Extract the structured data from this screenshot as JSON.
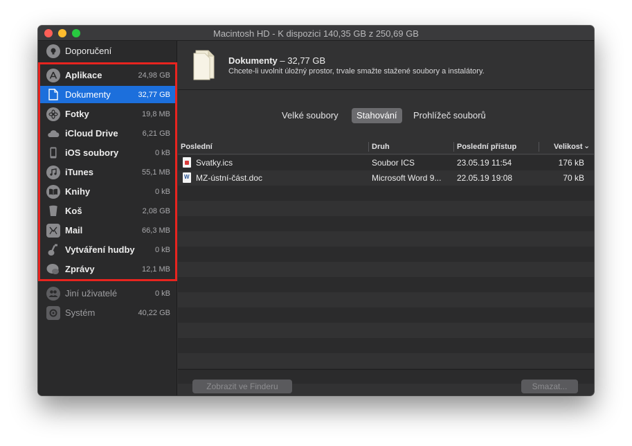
{
  "window": {
    "title": "Macintosh HD - K dispozici 140,35 GB z 250,69 GB"
  },
  "sidebar": {
    "recommendations": {
      "label": "Doporučení",
      "icon": "lightbulb-icon"
    },
    "items": [
      {
        "label": "Aplikace",
        "size": "24,98 GB",
        "icon": "app-store-icon"
      },
      {
        "label": "Dokumenty",
        "size": "32,77 GB",
        "icon": "document-icon",
        "selected": true
      },
      {
        "label": "Fotky",
        "size": "19,8 MB",
        "icon": "photos-icon"
      },
      {
        "label": "iCloud Drive",
        "size": "6,21 GB",
        "icon": "cloud-icon"
      },
      {
        "label": "iOS soubory",
        "size": "0 kB",
        "icon": "iphone-icon"
      },
      {
        "label": "iTunes",
        "size": "55,1 MB",
        "icon": "music-note-icon"
      },
      {
        "label": "Knihy",
        "size": "0 kB",
        "icon": "book-icon"
      },
      {
        "label": "Koš",
        "size": "2,08 GB",
        "icon": "trash-icon"
      },
      {
        "label": "Mail",
        "size": "66,3 MB",
        "icon": "mail-icon"
      },
      {
        "label": "Vytváření hudby",
        "size": "0 kB",
        "icon": "guitar-icon"
      },
      {
        "label": "Zprávy",
        "size": "12,1 MB",
        "icon": "messages-icon"
      }
    ],
    "other_users": {
      "label": "Jiní uživatelé",
      "size": "0 kB",
      "icon": "users-icon"
    },
    "system": {
      "label": "Systém",
      "size": "40,22 GB",
      "icon": "gear-icon"
    }
  },
  "header": {
    "title": "Dokumenty",
    "title_suffix": " – 32,77 GB",
    "description": "Chcete-li uvolnit úložný prostor, trvale smažte stažené soubory a instalátory."
  },
  "tabs": [
    {
      "label": "Velké soubory",
      "active": false
    },
    {
      "label": "Stahování",
      "active": true
    },
    {
      "label": "Prohlížeč souborů",
      "active": false
    }
  ],
  "table": {
    "columns": [
      "Poslední",
      "Druh",
      "Poslední přístup",
      "Velikost"
    ],
    "sort_indicator": "⌄",
    "rows": [
      {
        "name": "Svatky.ics",
        "kind": "Soubor ICS",
        "accessed": "23.05.19 11:54",
        "size": "176 kB",
        "icon": "ics-file-icon"
      },
      {
        "name": "MZ-ústní-část.doc",
        "kind": "Microsoft Word 9...",
        "accessed": "22.05.19 19:08",
        "size": "70 kB",
        "icon": "word-file-icon"
      }
    ]
  },
  "footer": {
    "show_in_finder": "Zobrazit ve Finderu",
    "delete": "Smazat..."
  }
}
